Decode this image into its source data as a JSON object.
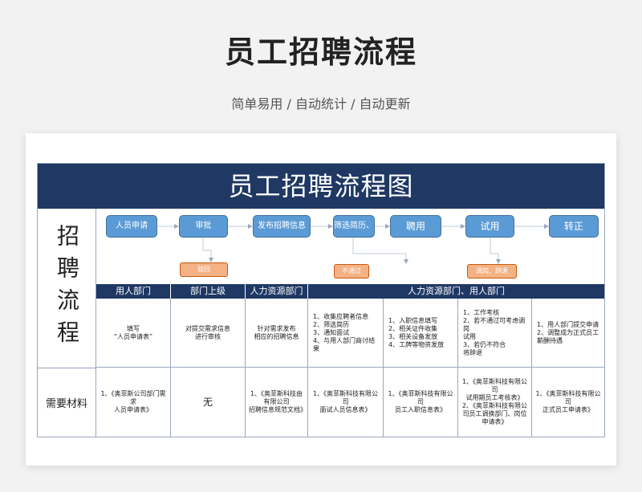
{
  "header": {
    "title": "员工招聘流程",
    "subtitle": "简单易用 / 自动统计 / 自动更新"
  },
  "sheet": {
    "banner": "员工招聘流程图",
    "side_label": "招聘流程",
    "materials_label": "需要材料",
    "flow": {
      "steps": [
        "人员申请",
        "审批",
        "发布招聘信息",
        "筛选简历、",
        "聘用",
        "试用",
        "转正"
      ],
      "branches": [
        "驳回",
        "不通过",
        "调岗、辞退"
      ]
    },
    "column_headers": [
      "用人部门",
      "部门上级",
      "人力资源部门",
      "人力资源部门、用人部门"
    ],
    "process_cells": [
      "填写\n“人员申请表”",
      "对提交需求信息\n进行审核",
      "针对需求发布\n相应的招聘信息",
      "1、收集应聘者信息\n2、筛选简历\n3、通知面试\n4、与用人部门商讨结果",
      "1、入职信息填写\n2、相关证件收集\n3、相关设备发放\n4、工牌等物资发放",
      "1、工作考核\n2、若不通过可考虑调岗\n试用\n3、若仍不符合\n将辞退",
      "1、用人部门提交申请\n2、调整成为正式员工\n薪酬待遇"
    ],
    "material_cells": [
      "1、《奥菲斯公司部门需\n求\n人员申请表》",
      "无",
      "1、《奥菲斯科技由\n有限公司\n招聘信息规范文档》",
      "1、《奥菲斯科技有限公\n司\n面试人员信息表》",
      "1、《奥菲斯科技有限公司\n员工入职信息表》",
      "1、《奥菲斯科技有限公\n司\n试用期员工考核表》\n2、《奥菲斯科技有限公\n司员工调换部门、岗位\n申请表》",
      "1、《奥菲斯科技有限公\n司\n正式员工申请表》"
    ]
  },
  "colors": {
    "navy": "#1f3864",
    "step_blue": "#5b9bd5",
    "branch_orange": "#f4b183"
  }
}
